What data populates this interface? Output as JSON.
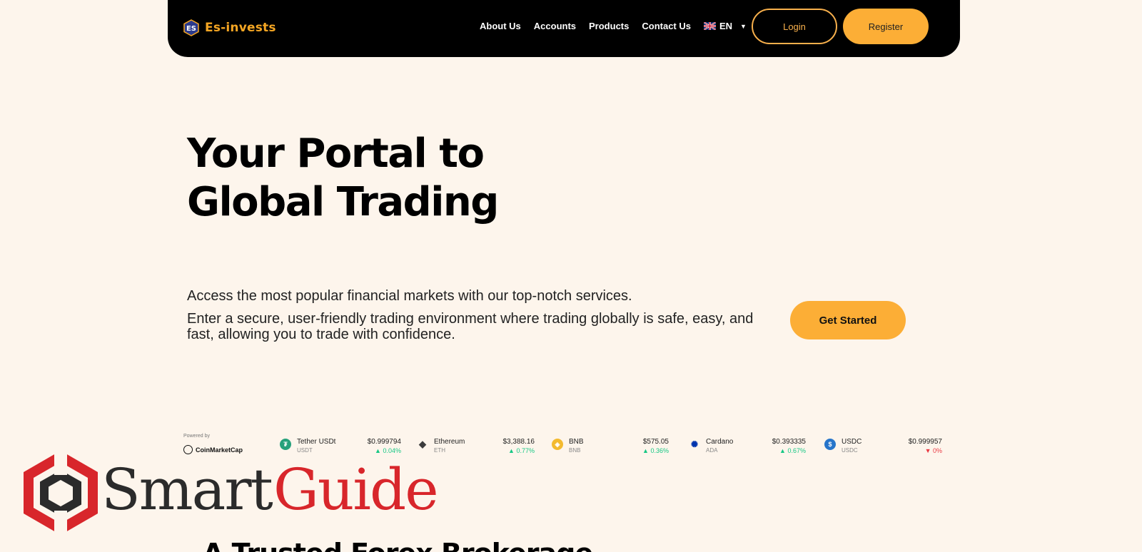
{
  "header": {
    "brand": "Es-invests",
    "nav": [
      "About Us",
      "Accounts",
      "Products",
      "Contact Us"
    ],
    "language": "EN",
    "login_label": "Login",
    "register_label": "Register"
  },
  "hero": {
    "title_line1": "Your Portal to",
    "title_line2": "Global Trading",
    "text1": "Access the most popular financial markets with our top-notch services.",
    "text2": "Enter a secure, user-friendly trading environment where trading globally is safe, easy, and fast, allowing you to trade with confidence.",
    "cta_label": "Get Started"
  },
  "ticker": {
    "powered_by": "Powered by",
    "provider": "CoinMarketCap",
    "coins": [
      {
        "name": "Tether USDt",
        "symbol": "USDT",
        "price": "$0.999794",
        "change": "0.04%",
        "direction": "up",
        "icon_color": "#26a17b",
        "icon": "tether-icon"
      },
      {
        "name": "Ethereum",
        "symbol": "ETH",
        "price": "$3,388.16",
        "change": "0.77%",
        "direction": "up",
        "icon_color": "#3c3c3d",
        "icon": "ethereum-icon"
      },
      {
        "name": "BNB",
        "symbol": "BNB",
        "price": "$575.05",
        "change": "0.36%",
        "direction": "up",
        "icon_color": "#f3ba2f",
        "icon": "bnb-icon"
      },
      {
        "name": "Cardano",
        "symbol": "ADA",
        "price": "$0.393335",
        "change": "0.67%",
        "direction": "up",
        "icon_color": "#0033ad",
        "icon": "cardano-icon"
      },
      {
        "name": "USDC",
        "symbol": "USDC",
        "price": "$0.999957",
        "change": "0%",
        "direction": "down",
        "icon_color": "#2775ca",
        "icon": "usdc-icon"
      }
    ]
  },
  "watermark": {
    "word1": "Smart",
    "word2": "Guide"
  },
  "section": {
    "title": "A Trusted Forex Brokerage"
  },
  "colors": {
    "background": "#fdf5ec",
    "accent": "#fcae36",
    "header_bg": "#000000",
    "up": "#16c784",
    "down": "#ea3943",
    "watermark_red": "#d8262b"
  }
}
